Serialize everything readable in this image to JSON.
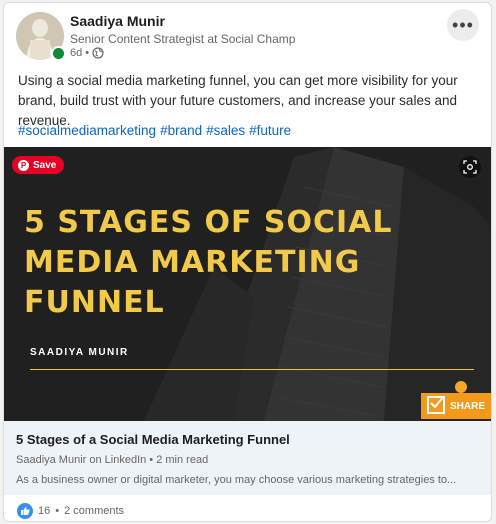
{
  "post": {
    "author": {
      "name": "Saadiya Munir",
      "title": "Senior Content Strategist at Social Champ",
      "age": "6d",
      "separator": "•"
    },
    "more_label": "•••",
    "body": "Using a social media marketing funnel, you can get more visibility for your brand, build trust with your future customers, and increase your sales and revenue.",
    "hashtags": [
      "#socialmediamarketing",
      "#brand",
      "#sales",
      "#future"
    ]
  },
  "image": {
    "save_label": "Save",
    "pin_glyph": "P",
    "headline": "5 STAGES OF SOCIAL MEDIA MARKETING FUNNEL",
    "byline": "SAADIYA MUNIR",
    "share_label": "SHARE"
  },
  "link": {
    "title": "5 Stages of a Social Media Marketing Funnel",
    "source": "Saadiya Munir on LinkedIn • 2 min read",
    "description": "As a business owner or digital marketer, you may choose various marketing strategies to..."
  },
  "social": {
    "reactions": "16",
    "separator": "•",
    "comments": "2 comments"
  },
  "colors": {
    "accent": "#0a66c2",
    "headline": "#f1c94b",
    "save": "#e60023",
    "share": "#f39a1c",
    "online": "#0a8a3a"
  },
  "icons": [
    "globe-icon",
    "more-icon",
    "pinterest-icon",
    "lens-icon",
    "share-check-icon",
    "like-icon"
  ]
}
